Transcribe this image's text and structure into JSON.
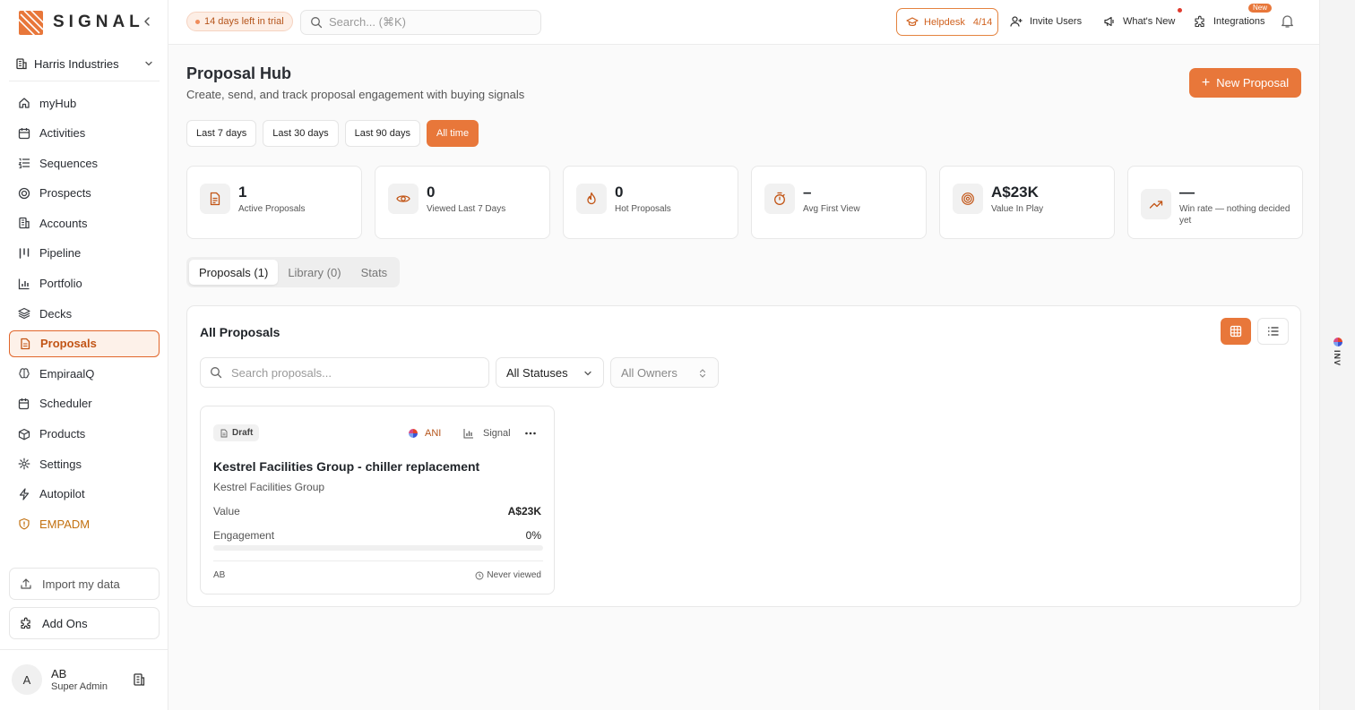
{
  "brand": {
    "name": "SIGNAL",
    "accent": "#e8773a"
  },
  "sidebar": {
    "org": "Harris Industries",
    "items": [
      {
        "label": "myHub",
        "icon": "home-icon"
      },
      {
        "label": "Activities",
        "icon": "calendar-icon"
      },
      {
        "label": "Sequences",
        "icon": "list-ordered-icon"
      },
      {
        "label": "Prospects",
        "icon": "target-icon"
      },
      {
        "label": "Accounts",
        "icon": "building-icon"
      },
      {
        "label": "Pipeline",
        "icon": "kanban-icon"
      },
      {
        "label": "Portfolio",
        "icon": "bar-chart-icon"
      },
      {
        "label": "Decks",
        "icon": "layers-icon"
      },
      {
        "label": "Proposals",
        "icon": "document-icon",
        "active": true
      },
      {
        "label": "EmpiraalQ",
        "icon": "brain-icon"
      },
      {
        "label": "Scheduler",
        "icon": "calendar-clock-icon"
      },
      {
        "label": "Products",
        "icon": "package-icon"
      },
      {
        "label": "Settings",
        "icon": "settings-icon"
      },
      {
        "label": "Autopilot",
        "icon": "zap-icon"
      },
      {
        "label": "EMPADM",
        "icon": "shield-icon",
        "admin": true
      }
    ],
    "import_label": "Import my data",
    "addons_label": "Add Ons",
    "user": {
      "initial": "A",
      "name": "AB",
      "role": "Super Admin"
    }
  },
  "topbar": {
    "trial": "14 days left in trial",
    "search_placeholder": "Search... (⌘K)",
    "helpdesk_label": "Helpdesk",
    "helpdesk_count": "4/14",
    "invite": "Invite Users",
    "whats_new": "What's New",
    "integrations": "Integrations",
    "new_badge": "New"
  },
  "right_rail": {
    "label": "INV"
  },
  "page": {
    "title": "Proposal Hub",
    "subtitle": "Create, send, and track proposal engagement with buying signals",
    "new_button": "New Proposal",
    "ranges": [
      "Last 7 days",
      "Last 30 days",
      "Last 90 days",
      "All time"
    ],
    "active_range": "All time"
  },
  "stats": [
    {
      "value": "1",
      "label": "Active Proposals",
      "icon": "document-icon"
    },
    {
      "value": "0",
      "label": "Viewed Last 7 Days",
      "icon": "eye-icon"
    },
    {
      "value": "0",
      "label": "Hot Proposals",
      "icon": "flame-icon"
    },
    {
      "value": "–",
      "label": "Avg First View",
      "icon": "timer-icon"
    },
    {
      "value": "A$23K",
      "label": "Value In Play",
      "icon": "target-icon"
    },
    {
      "value": "—",
      "label": "Win rate — nothing decided yet",
      "icon": "trending-up-icon"
    }
  ],
  "tabs": [
    "Proposals (1)",
    "Library (0)",
    "Stats"
  ],
  "panel": {
    "title": "All Proposals",
    "search_placeholder": "Search proposals...",
    "status_filter": "All Statuses",
    "owner_filter": "All Owners"
  },
  "proposal": {
    "status": "Draft",
    "integration": "ANI",
    "signal_label": "Signal",
    "title": "Kestrel Facilities Group - chiller replacement",
    "company": "Kestrel Facilities Group",
    "value_label": "Value",
    "value": "A$23K",
    "engagement_label": "Engagement",
    "engagement": "0%",
    "engagement_fraction": 0,
    "owner": "AB",
    "viewed": "Never viewed"
  }
}
